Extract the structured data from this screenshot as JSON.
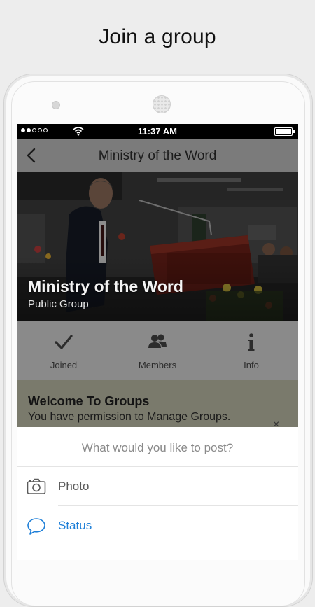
{
  "promo": {
    "headline": "Join a group"
  },
  "status_bar": {
    "time": "11:37 AM",
    "signal_filled": 2,
    "signal_total": 5
  },
  "nav": {
    "title": "Ministry of the Word",
    "back_icon": "chevron-left-icon"
  },
  "hero": {
    "group_name": "Ministry of the Word",
    "group_type": "Public Group"
  },
  "actions": [
    {
      "label": "Joined",
      "icon": "check-icon"
    },
    {
      "label": "Members",
      "icon": "members-icon"
    },
    {
      "label": "Info",
      "icon": "info-icon"
    }
  ],
  "welcome": {
    "title": "Welcome To Groups",
    "text": "You have permission to Manage Groups.",
    "close_glyph": "×"
  },
  "post_sheet": {
    "prompt": "What would you like to post?",
    "options": [
      {
        "label": "Photo",
        "icon": "camera-icon",
        "color": "#5a5a5a"
      },
      {
        "label": "Status",
        "icon": "chat-bubble-icon",
        "color": "#1e7fd8"
      }
    ]
  },
  "colors": {
    "accent": "#1e7fd8",
    "overlay_gray": "#7b7b7b"
  }
}
